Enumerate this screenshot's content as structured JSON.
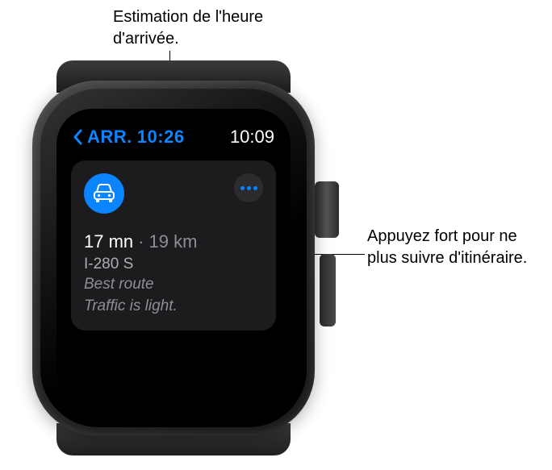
{
  "callouts": {
    "top": "Estimation de l'heure d'arrivée.",
    "right": "Appuyez fort pour ne plus suivre d'itinéraire."
  },
  "status": {
    "arrival_prefix": "ARR.",
    "arrival_time": "10:26",
    "clock": "10:09"
  },
  "route": {
    "mode_icon": "car-icon",
    "more_icon": "ellipsis-icon",
    "duration": "17 mn",
    "distance": "19 km",
    "road": "I-280 S",
    "note_line1": "Best route",
    "note_line2": "Traffic is light."
  },
  "colors": {
    "accent": "#0a84ff",
    "card_bg": "#1c1c1e",
    "secondary_text": "#8e8e93"
  }
}
